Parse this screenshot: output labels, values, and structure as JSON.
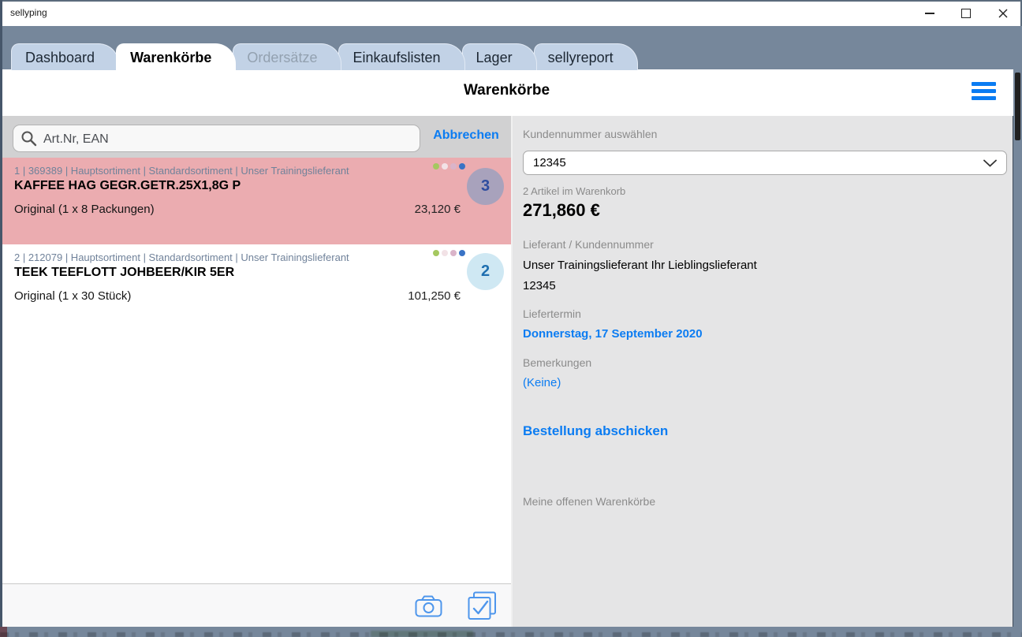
{
  "colors": {
    "accent": "#0b7cf2",
    "slate": "#76879b",
    "tab_fill": "#c2d2e6",
    "panel_bg": "#e5e5e6",
    "search_row_bg": "#d1d1d2",
    "selected_row_bg": "#ebacb0",
    "meta_text": "#70829a",
    "label_gray": "#8b8b8b",
    "icon_blue": "#4e96ec"
  },
  "window": {
    "title": "sellyping"
  },
  "tabs": [
    {
      "label": "Dashboard",
      "state": "normal"
    },
    {
      "label": "Warenkörbe",
      "state": "active"
    },
    {
      "label": "Ordersätze",
      "state": "disabled"
    },
    {
      "label": "Einkaufslisten",
      "state": "normal"
    },
    {
      "label": "Lager",
      "state": "normal"
    },
    {
      "label": "sellyreport",
      "state": "normal"
    }
  ],
  "header": {
    "title": "Warenkörbe"
  },
  "search": {
    "placeholder": "Art.Nr, EAN",
    "cancel_label": "Abbrechen"
  },
  "cart_items": [
    {
      "meta": "1 | 369389 | Hauptsortiment | Standardsortiment | Unser Trainingslieferant",
      "name": "KAFFEE HAG GEGR.GETR.25X1,8G P",
      "variant": "Original (1 x 8 Packungen)",
      "price": "23,120 €",
      "quantity": "3",
      "selected": true,
      "dot_colors": [
        "#a5c860",
        "#f2e2e6",
        "#dab4c9",
        "#3973c5"
      ],
      "badge_bg": "#a8a2bc",
      "badge_fg": "#2e4d9f"
    },
    {
      "meta": "2 | 212079 | Hauptsortiment | Standardsortiment | Unser Trainingslieferant",
      "name": "TEEK TEEFLOTT JOHBEER/KIR 5ER",
      "variant": "Original (1 x 30 Stück)",
      "price": "101,250 €",
      "quantity": "2",
      "selected": false,
      "dot_colors": [
        "#a5c860",
        "#f2e2e6",
        "#dab4c9",
        "#3973c5"
      ],
      "badge_bg": "#cfe8f3",
      "badge_fg": "#1e6fb0"
    }
  ],
  "summary": {
    "customer_label": "Kundennummer auswählen",
    "customer_value": "12345",
    "count_text": "2 Artikel im Warenkorb",
    "total": "271,860 €",
    "supplier_label": "Lieferant / Kundennummer",
    "supplier_name": "Unser Trainingslieferant Ihr Lieblingslieferant",
    "supplier_customer_no": "12345",
    "delivery_label": "Liefertermin",
    "delivery_date": "Donnerstag, 17 September 2020",
    "remarks_label": "Bemerkungen",
    "remarks_value": "(Keine)",
    "submit_label": "Bestellung abschicken",
    "open_carts_label": "Meine offenen Warenkörbe"
  }
}
